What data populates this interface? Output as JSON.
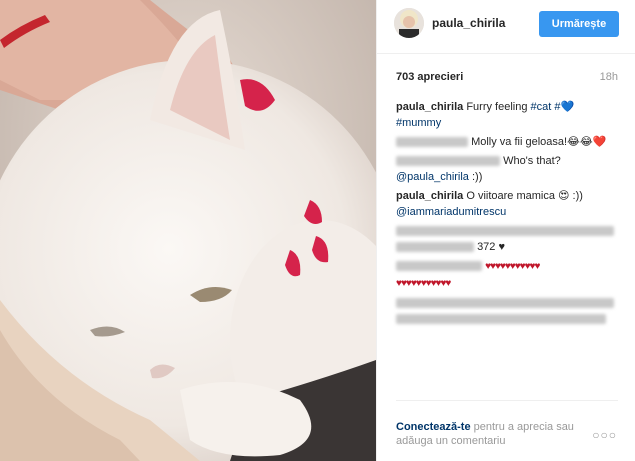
{
  "post": {
    "username": "paula_chirila",
    "follow_label": "Urmărește",
    "likes": "703 aprecieri",
    "time": "18h"
  },
  "comments": {
    "c1_user": "paula_chirila",
    "c1_text": "Furry feeling",
    "c1_tag1": "#cat",
    "c1_tag2": "#",
    "c1_heart": "💙",
    "c1_tag3": "#mummy",
    "c2_text": "Molly va fii geloasa!😂😂❤️",
    "c3_text": "Who's that?",
    "c3_mention": "@paula_chirila",
    "c3_suffix": ":))",
    "c4_user": "paula_chirila",
    "c4_text": "O viitoare mamica 😍 :))",
    "c4_mention": "@iammariadumitrescu",
    "c5_text": "372 ♥",
    "c6_hearts1": "♥♥♥♥♥♥♥♥♥♥♥",
    "c6_hearts2": "♥♥♥♥♥♥♥♥♥♥♥"
  },
  "footer": {
    "login_label": "Conectează-te",
    "rest": "pentru a aprecia sau adăuga un comentariu",
    "more": "○○○"
  }
}
